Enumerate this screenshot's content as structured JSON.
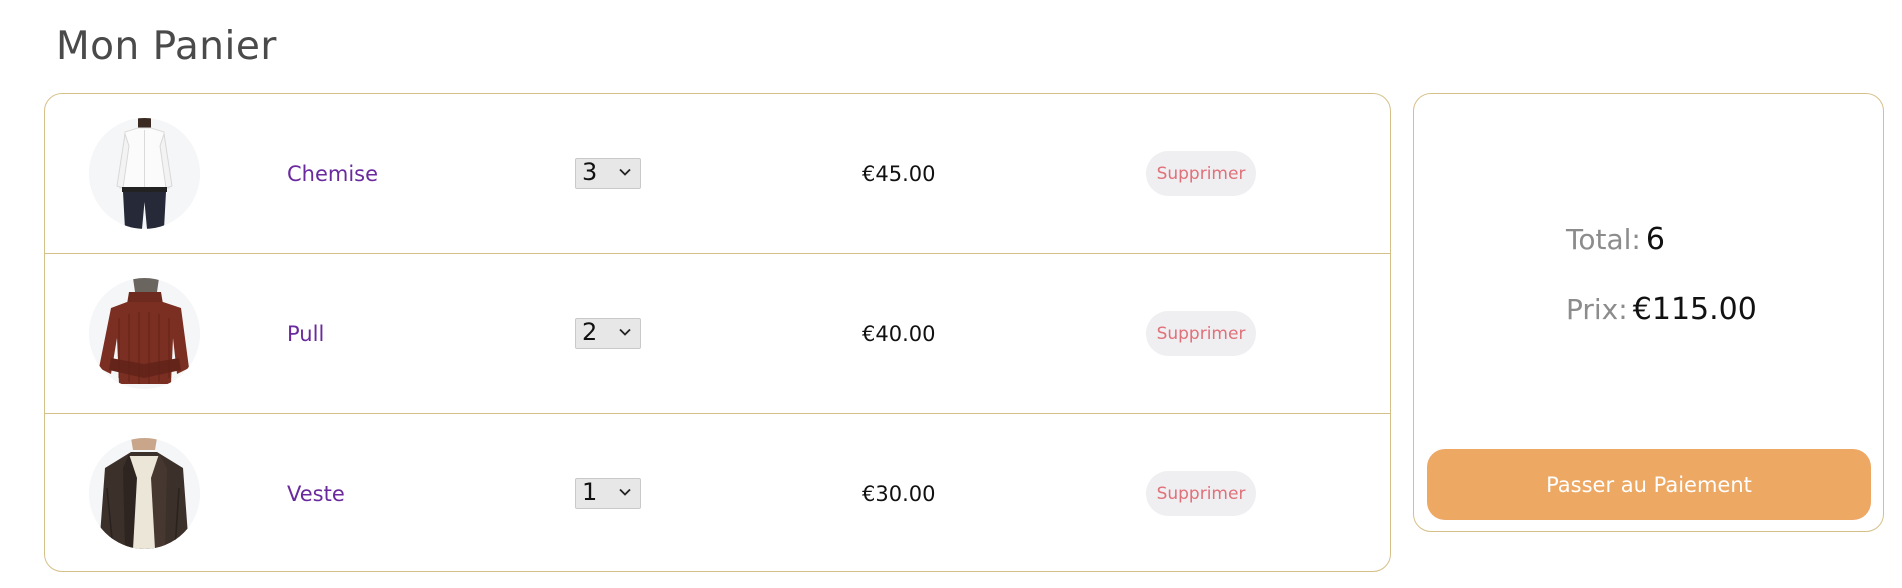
{
  "page": {
    "title": "Mon Panier"
  },
  "cart": {
    "items": [
      {
        "name": "Chemise",
        "quantity": "3",
        "price": "€45.00",
        "remove_label": "Supprimer",
        "image": "white-shirt-photo"
      },
      {
        "name": "Pull",
        "quantity": "2",
        "price": "€40.00",
        "remove_label": "Supprimer",
        "image": "brown-turtleneck-sweater-photo"
      },
      {
        "name": "Veste",
        "quantity": "1",
        "price": "€30.00",
        "remove_label": "Supprimer",
        "image": "leather-jacket-photo"
      }
    ]
  },
  "summary": {
    "total_label": "Total:",
    "total_value": "6",
    "price_label": "Prix:",
    "price_value": "€115.00",
    "checkout_label": "Passer au Paiement"
  },
  "colors": {
    "accent": "#eda864",
    "border": "#d6c089",
    "item_name": "#6a2a9e",
    "remove_text": "#e0707a"
  }
}
